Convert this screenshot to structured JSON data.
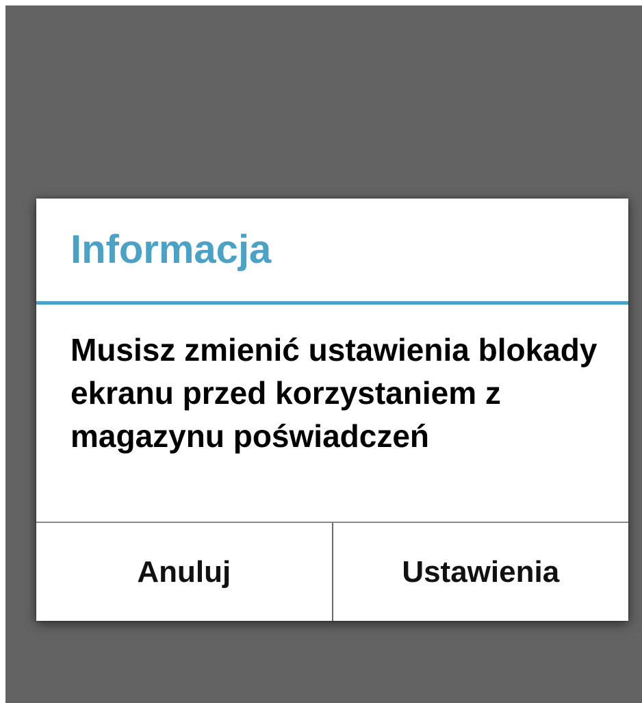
{
  "dialog": {
    "title": "Informacja",
    "message": "Musisz zmienić ustawienia blokady ekranu przed korzystaniem z magazynu poświadczeń",
    "buttons": {
      "cancel_label": "Anuluj",
      "settings_label": "Ustawienia"
    }
  },
  "colors": {
    "backdrop": "#636363",
    "accent": "#4aa3c6",
    "dialog_background": "#ffffff",
    "text": "#000000"
  }
}
